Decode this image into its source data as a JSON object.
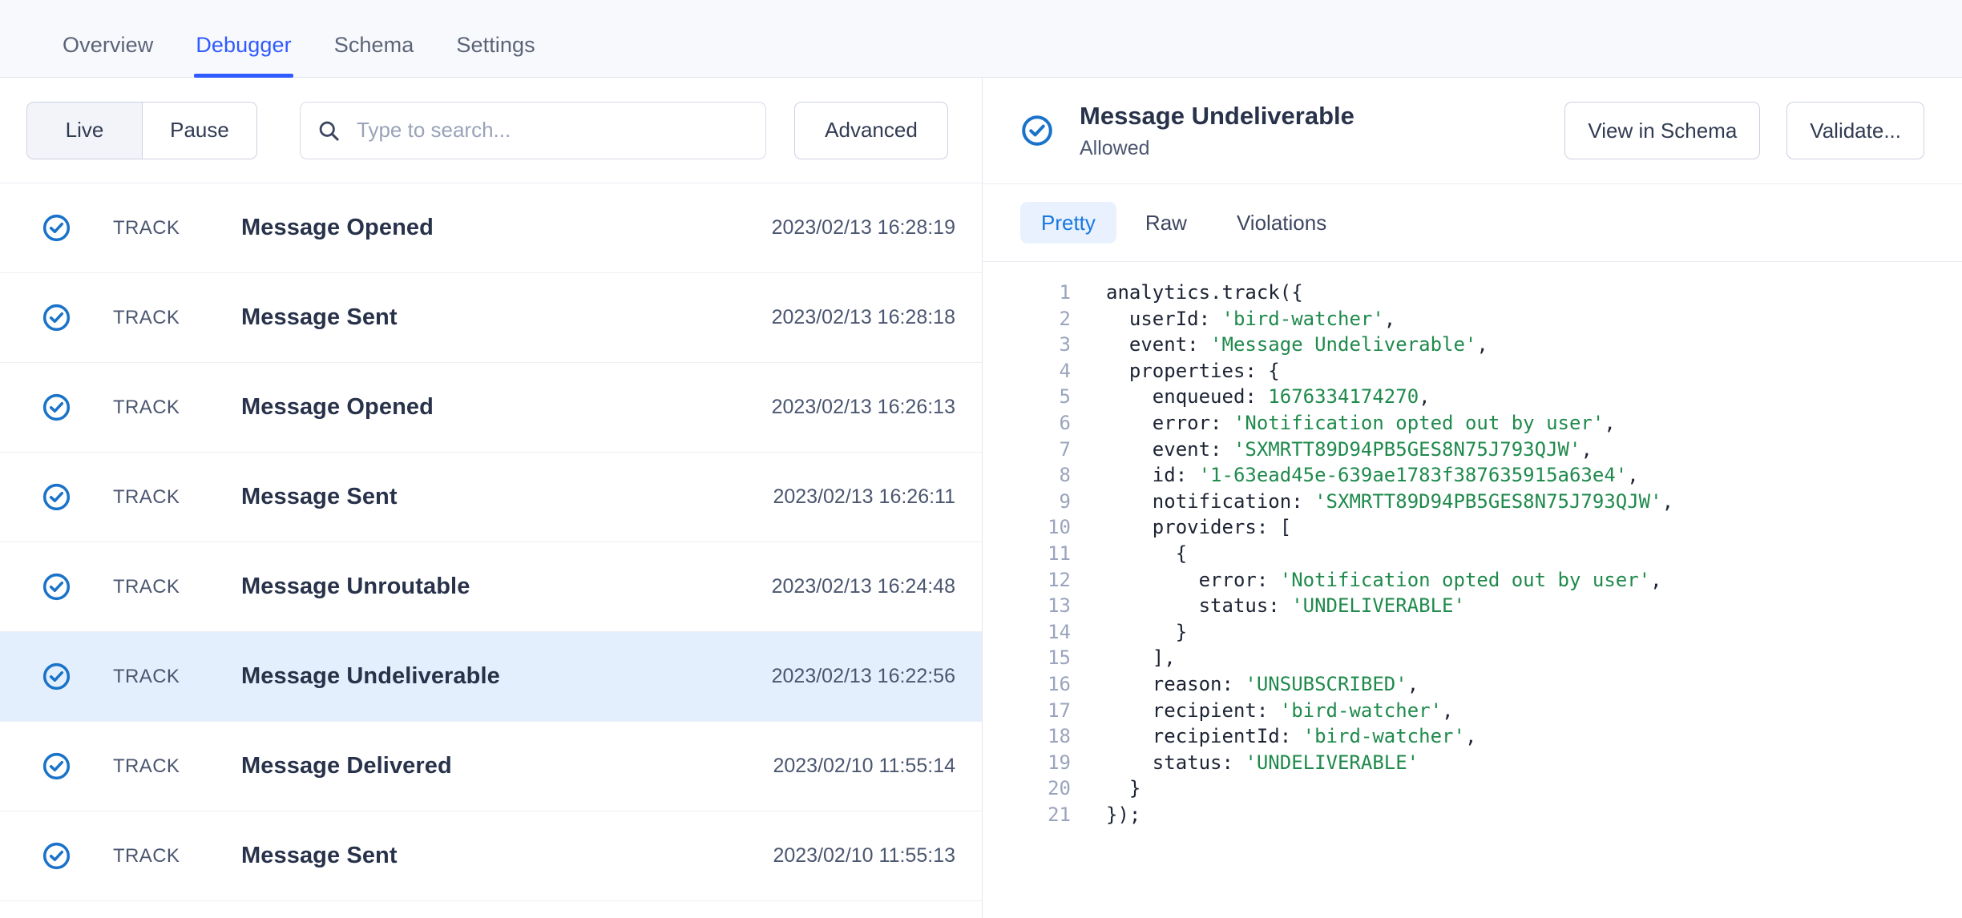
{
  "topnav": {
    "tabs": [
      {
        "label": "Overview",
        "active": false
      },
      {
        "label": "Debugger",
        "active": true
      },
      {
        "label": "Schema",
        "active": false
      },
      {
        "label": "Settings",
        "active": false
      }
    ]
  },
  "colors": {
    "accent_blue": "#2f5bff",
    "link_blue": "#1877e0",
    "status_blue": "#1a73c9",
    "selected_row": "#e3effc",
    "string_green": "#1f8a4c",
    "text_dark": "#28324a"
  },
  "left_panel": {
    "stream_toggle": {
      "live_label": "Live",
      "pause_label": "Pause",
      "selected": "Live"
    },
    "search": {
      "placeholder": "Type to search...",
      "value": "",
      "icon": "search-icon"
    },
    "advanced_label": "Advanced",
    "column_type_label": "TRACK",
    "events": [
      {
        "status_icon": "check-circle-icon",
        "type": "TRACK",
        "name": "Message Opened",
        "timestamp": "2023/02/13 16:28:19",
        "selected": false
      },
      {
        "status_icon": "check-circle-icon",
        "type": "TRACK",
        "name": "Message Sent",
        "timestamp": "2023/02/13 16:28:18",
        "selected": false
      },
      {
        "status_icon": "check-circle-icon",
        "type": "TRACK",
        "name": "Message Opened",
        "timestamp": "2023/02/13 16:26:13",
        "selected": false
      },
      {
        "status_icon": "check-circle-icon",
        "type": "TRACK",
        "name": "Message Sent",
        "timestamp": "2023/02/13 16:26:11",
        "selected": false
      },
      {
        "status_icon": "check-circle-icon",
        "type": "TRACK",
        "name": "Message Unroutable",
        "timestamp": "2023/02/13 16:24:48",
        "selected": false
      },
      {
        "status_icon": "check-circle-icon",
        "type": "TRACK",
        "name": "Message Undeliverable",
        "timestamp": "2023/02/13 16:22:56",
        "selected": true
      },
      {
        "status_icon": "check-circle-icon",
        "type": "TRACK",
        "name": "Message Delivered",
        "timestamp": "2023/02/10 11:55:14",
        "selected": false
      },
      {
        "status_icon": "check-circle-icon",
        "type": "TRACK",
        "name": "Message Sent",
        "timestamp": "2023/02/10 11:55:13",
        "selected": false
      }
    ]
  },
  "right_panel": {
    "status_icon": "check-circle-icon",
    "title": "Message Undeliverable",
    "subtitle": "Allowed",
    "actions": [
      {
        "label": "View in Schema"
      },
      {
        "label": "Validate..."
      }
    ],
    "tabs": [
      {
        "label": "Pretty",
        "active": true
      },
      {
        "label": "Raw",
        "active": false
      },
      {
        "label": "Violations",
        "active": false
      }
    ],
    "code": {
      "language": "javascript",
      "lines": [
        {
          "n": "1",
          "segments": [
            {
              "t": "analytics.track({",
              "k": "plain"
            }
          ]
        },
        {
          "n": "2",
          "segments": [
            {
              "t": "  userId: ",
              "k": "plain"
            },
            {
              "t": "'bird-watcher'",
              "k": "str"
            },
            {
              "t": ",",
              "k": "plain"
            }
          ]
        },
        {
          "n": "3",
          "segments": [
            {
              "t": "  event: ",
              "k": "plain"
            },
            {
              "t": "'Message Undeliverable'",
              "k": "str"
            },
            {
              "t": ",",
              "k": "plain"
            }
          ]
        },
        {
          "n": "4",
          "segments": [
            {
              "t": "  properties: {",
              "k": "plain"
            }
          ]
        },
        {
          "n": "5",
          "segments": [
            {
              "t": "    enqueued: ",
              "k": "plain"
            },
            {
              "t": "1676334174270",
              "k": "num"
            },
            {
              "t": ",",
              "k": "plain"
            }
          ]
        },
        {
          "n": "6",
          "segments": [
            {
              "t": "    error: ",
              "k": "plain"
            },
            {
              "t": "'Notification opted out by user'",
              "k": "str"
            },
            {
              "t": ",",
              "k": "plain"
            }
          ]
        },
        {
          "n": "7",
          "segments": [
            {
              "t": "    event: ",
              "k": "plain"
            },
            {
              "t": "'SXMRTT89D94PB5GES8N75J793QJW'",
              "k": "str"
            },
            {
              "t": ",",
              "k": "plain"
            }
          ]
        },
        {
          "n": "8",
          "segments": [
            {
              "t": "    id: ",
              "k": "plain"
            },
            {
              "t": "'1-63ead45e-639ae1783f387635915a63e4'",
              "k": "str"
            },
            {
              "t": ",",
              "k": "plain"
            }
          ]
        },
        {
          "n": "9",
          "segments": [
            {
              "t": "    notification: ",
              "k": "plain"
            },
            {
              "t": "'SXMRTT89D94PB5GES8N75J793QJW'",
              "k": "str"
            },
            {
              "t": ",",
              "k": "plain"
            }
          ]
        },
        {
          "n": "10",
          "segments": [
            {
              "t": "    providers: [",
              "k": "plain"
            }
          ]
        },
        {
          "n": "11",
          "segments": [
            {
              "t": "      {",
              "k": "plain"
            }
          ]
        },
        {
          "n": "12",
          "segments": [
            {
              "t": "        error: ",
              "k": "plain"
            },
            {
              "t": "'Notification opted out by user'",
              "k": "str"
            },
            {
              "t": ",",
              "k": "plain"
            }
          ]
        },
        {
          "n": "13",
          "segments": [
            {
              "t": "        status: ",
              "k": "plain"
            },
            {
              "t": "'UNDELIVERABLE'",
              "k": "str"
            }
          ]
        },
        {
          "n": "14",
          "segments": [
            {
              "t": "      }",
              "k": "plain"
            }
          ]
        },
        {
          "n": "15",
          "segments": [
            {
              "t": "    ],",
              "k": "plain"
            }
          ]
        },
        {
          "n": "16",
          "segments": [
            {
              "t": "    reason: ",
              "k": "plain"
            },
            {
              "t": "'UNSUBSCRIBED'",
              "k": "str"
            },
            {
              "t": ",",
              "k": "plain"
            }
          ]
        },
        {
          "n": "17",
          "segments": [
            {
              "t": "    recipient: ",
              "k": "plain"
            },
            {
              "t": "'bird-watcher'",
              "k": "str"
            },
            {
              "t": ",",
              "k": "plain"
            }
          ]
        },
        {
          "n": "18",
          "segments": [
            {
              "t": "    recipientId: ",
              "k": "plain"
            },
            {
              "t": "'bird-watcher'",
              "k": "str"
            },
            {
              "t": ",",
              "k": "plain"
            }
          ]
        },
        {
          "n": "19",
          "segments": [
            {
              "t": "    status: ",
              "k": "plain"
            },
            {
              "t": "'UNDELIVERABLE'",
              "k": "str"
            }
          ]
        },
        {
          "n": "20",
          "segments": [
            {
              "t": "  }",
              "k": "plain"
            }
          ]
        },
        {
          "n": "21",
          "segments": [
            {
              "t": "});",
              "k": "plain"
            }
          ]
        }
      ]
    }
  }
}
